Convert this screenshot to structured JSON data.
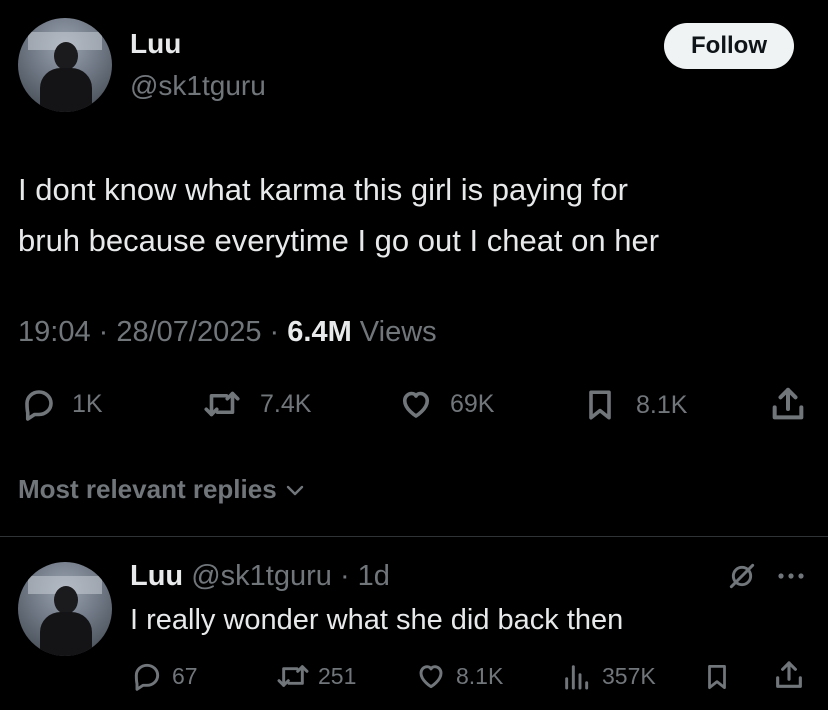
{
  "tweet": {
    "author_name": "Luu",
    "author_handle": "@sk1tguru",
    "follow_label": "Follow",
    "text_line1": "I dont know what karma this girl is paying for",
    "text_line2": "bruh because everytime I go out I cheat on her",
    "timestamp": "19:04 · 28/07/2025 · ",
    "views_count": "6.4M",
    "views_label": " Views",
    "actions": {
      "replies": "1K",
      "reposts": "7.4K",
      "likes": "69K",
      "bookmarks": "8.1K"
    }
  },
  "replies_section": {
    "label": "Most relevant replies"
  },
  "reply": {
    "author_name": "Luu",
    "author_handle": "@sk1tguru",
    "age": "· 1d",
    "text": "I really wonder what she did back then",
    "actions": {
      "replies": "67",
      "reposts": "251",
      "likes": "8.1K",
      "views": "357K"
    }
  },
  "colors": {
    "background": "#000000",
    "text_primary": "#e7e9ea",
    "text_secondary": "#71767b",
    "follow_bg": "#eff3f4",
    "divider": "#2f3336"
  },
  "icons": [
    "reply-icon",
    "repost-icon",
    "like-icon",
    "bookmark-icon",
    "share-icon",
    "views-icon",
    "grok-icon",
    "more-icon",
    "chevron-down-icon"
  ]
}
